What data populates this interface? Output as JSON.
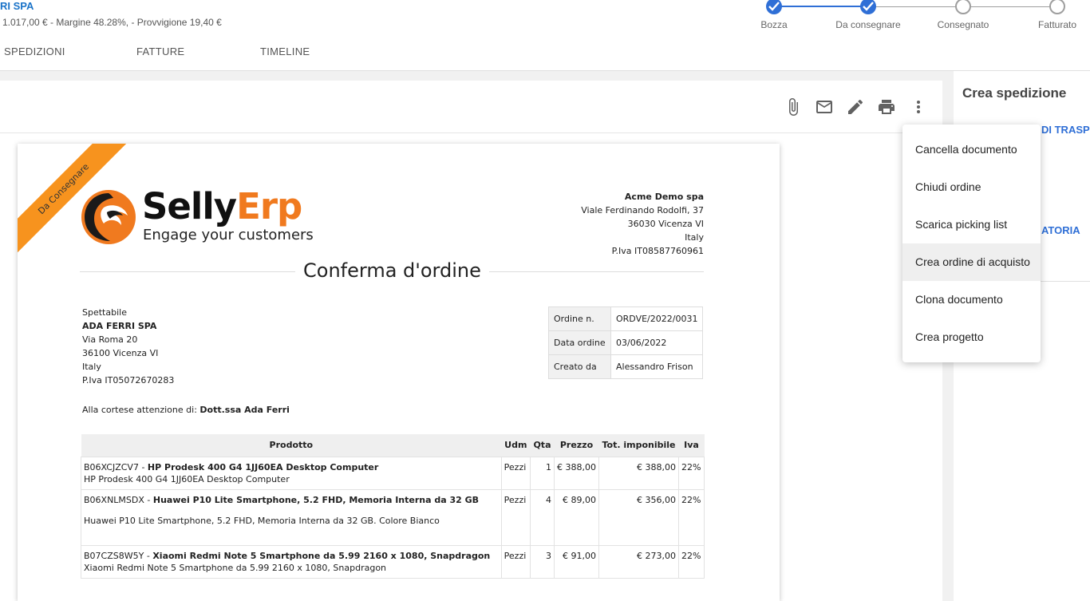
{
  "header": {
    "customer_name": "RI SPA",
    "summary": "1.017,00 € - Margine 48.28%, - Provvigione 19,40 €",
    "tabs": [
      {
        "label": "SPEDIZIONI"
      },
      {
        "label": "FATTURE"
      },
      {
        "label": "TIMELINE"
      }
    ]
  },
  "stepper": {
    "steps": [
      {
        "label": "Bozza",
        "status": "done"
      },
      {
        "label": "Da consegnare",
        "status": "done"
      },
      {
        "label": "Consegnato",
        "status": "todo"
      },
      {
        "label": "Fatturato",
        "status": "todo"
      }
    ],
    "accent": "#2f6fd6"
  },
  "toolbar": {
    "icons": [
      "attachment-icon",
      "mail-icon",
      "edit-icon",
      "print-icon",
      "more-vert-icon"
    ]
  },
  "right_panel": {
    "title": "Crea spedizione",
    "link1": "DI TRASP",
    "link2": "ATORIA"
  },
  "context_menu": {
    "items": [
      {
        "label": "Cancella documento"
      },
      {
        "label": "Chiudi ordine"
      },
      {
        "label": "Scarica picking list"
      },
      {
        "label": "Crea ordine di acquisto"
      },
      {
        "label": "Clona documento"
      },
      {
        "label": "Crea progetto"
      }
    ]
  },
  "document": {
    "ribbon": "Da Consegnare",
    "logo": {
      "word1": "Selly",
      "word2": "Erp",
      "tagline": "Engage your customers"
    },
    "company": {
      "name": "Acme Demo spa",
      "address": "Viale Ferdinando Rodolfi, 37",
      "city": "36030 Vicenza VI",
      "country": "Italy",
      "vat": "P.Iva IT08587760961"
    },
    "title": "Conferma d'ordine",
    "recipient": {
      "salutation": "Spettabile",
      "name": "ADA FERRI SPA",
      "address": "Via Roma 20",
      "city": "36100 Vicenza VI",
      "country": "Italy",
      "vat": "P.Iva IT05072670283"
    },
    "order_info": {
      "number_label": "Ordine n.",
      "number_value": "ORDVE/2022/0031",
      "date_label": "Data ordine",
      "date_value": "03/06/2022",
      "creator_label": "Creato da",
      "creator_value": "Alessandro Frison"
    },
    "attention": {
      "label": "Alla cortese attenzione di:",
      "name": "Dott.ssa Ada Ferri"
    },
    "table": {
      "headers": [
        "Prodotto",
        "Udm",
        "Qta",
        "Prezzo",
        "Tot. imponibile",
        "Iva"
      ],
      "rows": [
        {
          "code": "B06XCJZCV7 - ",
          "name": "HP Prodesk 400 G4 1JJ60EA Desktop Computer",
          "desc": "HP Prodesk 400 G4 1JJ60EA Desktop Computer",
          "udm": "Pezzi",
          "qta": "1",
          "prezzo": "€ 388,00",
          "tot": "€ 388,00",
          "iva": "22%"
        },
        {
          "code": "B06XNLMSDX - ",
          "name": "Huawei P10 Lite Smartphone, 5.2 FHD, Memoria Interna da 32 GB",
          "desc": "Huawei P10 Lite Smartphone, 5.2 FHD, Memoria Interna da 32 GB. Colore Bianco",
          "udm": "Pezzi",
          "qta": "4",
          "prezzo": "€ 89,00",
          "tot": "€ 356,00",
          "iva": "22%"
        },
        {
          "code": "B07CZS8W5Y - ",
          "name": "Xiaomi Redmi Note 5 Smartphone da 5.99 2160 x 1080, Snapdragon",
          "desc": "Xiaomi Redmi Note 5 Smartphone da 5.99 2160 x 1080, Snapdragon",
          "udm": "Pezzi",
          "qta": "3",
          "prezzo": "€ 91,00",
          "tot": "€ 273,00",
          "iva": "22%"
        }
      ]
    }
  }
}
